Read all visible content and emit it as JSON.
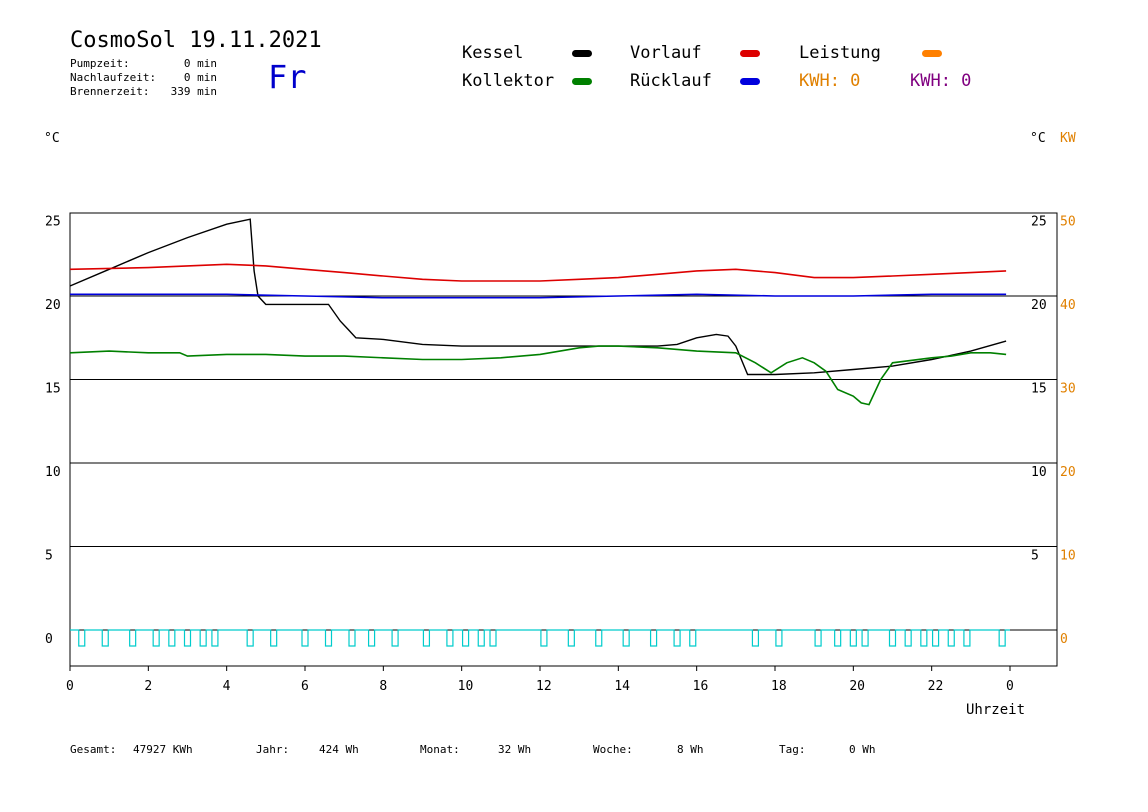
{
  "header": {
    "title": "CosmoSol 19.11.2021",
    "weekday": "Fr",
    "stats": [
      {
        "label": "Pumpzeit:",
        "value": "0 min"
      },
      {
        "label": "Nachlaufzeit:",
        "value": "0 min"
      },
      {
        "label": "Brennerzeit:",
        "value": "339 min"
      }
    ]
  },
  "legend": {
    "items": [
      {
        "label": "Kessel",
        "color": "#000000"
      },
      {
        "label": "Vorlauf",
        "color": "#dd0000"
      },
      {
        "label": "Leistung",
        "color": "#ff8000"
      },
      {
        "label": "Kollektor",
        "color": "#008000"
      },
      {
        "label": "Rücklauf",
        "color": "#0000dd"
      }
    ],
    "kwh_orange": "KWH: 0",
    "kwh_purple": "KWH: 0",
    "kwh_orange_color": "#e08000",
    "kwh_purple_color": "#800080"
  },
  "units": {
    "left": "°C",
    "right_c": "°C",
    "right_kw": "KW"
  },
  "footer": {
    "items": [
      {
        "label": "Gesamt:",
        "value": "47927 KWh"
      },
      {
        "label": "Jahr:",
        "value": "424 Wh"
      },
      {
        "label": "Monat:",
        "value": "32 Wh"
      },
      {
        "label": "Woche:",
        "value": "8 Wh"
      },
      {
        "label": "Tag:",
        "value": "0 Wh"
      }
    ]
  },
  "chart_data": {
    "type": "line",
    "xlabel": "Uhrzeit",
    "xlim": [
      0,
      24
    ],
    "ylim": [
      -2,
      26
    ],
    "x_ticks": [
      "0",
      "2",
      "4",
      "6",
      "8",
      "10",
      "12",
      "14",
      "16",
      "18",
      "20",
      "22",
      "0"
    ],
    "y_ticks_left": [
      25,
      20,
      15,
      10,
      5,
      0
    ],
    "y_ticks_right_c": [
      25,
      20,
      15,
      10,
      5
    ],
    "y_ticks_right_kw": [
      50,
      40,
      30,
      20,
      10,
      0
    ],
    "gridlines_y": [
      20,
      15,
      10,
      5,
      0
    ],
    "series": [
      {
        "name": "Kessel",
        "color": "#000000",
        "points": [
          [
            0,
            20.6
          ],
          [
            1,
            21.6
          ],
          [
            2,
            22.6
          ],
          [
            3,
            23.5
          ],
          [
            4,
            24.3
          ],
          [
            4.6,
            24.6
          ],
          [
            4.7,
            21.5
          ],
          [
            4.8,
            20.0
          ],
          [
            5,
            19.5
          ],
          [
            6,
            19.5
          ],
          [
            6.6,
            19.5
          ],
          [
            6.9,
            18.5
          ],
          [
            7.1,
            18.0
          ],
          [
            7.3,
            17.5
          ],
          [
            8,
            17.4
          ],
          [
            9,
            17.1
          ],
          [
            10,
            17.0
          ],
          [
            12,
            17.0
          ],
          [
            13,
            17.0
          ],
          [
            14,
            17.0
          ],
          [
            15,
            17.0
          ],
          [
            15.5,
            17.1
          ],
          [
            16,
            17.5
          ],
          [
            16.5,
            17.7
          ],
          [
            16.8,
            17.6
          ],
          [
            17,
            17.0
          ],
          [
            17.3,
            15.3
          ],
          [
            18,
            15.3
          ],
          [
            19,
            15.4
          ],
          [
            20,
            15.6
          ],
          [
            21,
            15.8
          ],
          [
            22,
            16.2
          ],
          [
            23,
            16.7
          ],
          [
            23.9,
            17.3
          ]
        ]
      },
      {
        "name": "Vorlauf",
        "color": "#dd0000",
        "points": [
          [
            0,
            21.6
          ],
          [
            2,
            21.7
          ],
          [
            4,
            21.9
          ],
          [
            5,
            21.8
          ],
          [
            6,
            21.6
          ],
          [
            7,
            21.4
          ],
          [
            8,
            21.2
          ],
          [
            9,
            21.0
          ],
          [
            10,
            20.9
          ],
          [
            12,
            20.9
          ],
          [
            13,
            21.0
          ],
          [
            14,
            21.1
          ],
          [
            15,
            21.3
          ],
          [
            16,
            21.5
          ],
          [
            17,
            21.6
          ],
          [
            18,
            21.4
          ],
          [
            19,
            21.1
          ],
          [
            20,
            21.1
          ],
          [
            21,
            21.2
          ],
          [
            22,
            21.3
          ],
          [
            23,
            21.4
          ],
          [
            23.9,
            21.5
          ]
        ]
      },
      {
        "name": "Rücklauf",
        "color": "#0000dd",
        "points": [
          [
            0,
            20.1
          ],
          [
            2,
            20.1
          ],
          [
            4,
            20.1
          ],
          [
            6,
            20.0
          ],
          [
            8,
            19.9
          ],
          [
            10,
            19.9
          ],
          [
            12,
            19.9
          ],
          [
            14,
            20.0
          ],
          [
            16,
            20.1
          ],
          [
            18,
            20.0
          ],
          [
            20,
            20.0
          ],
          [
            22,
            20.1
          ],
          [
            23.9,
            20.1
          ]
        ]
      },
      {
        "name": "Kollektor",
        "color": "#008000",
        "points": [
          [
            0,
            16.6
          ],
          [
            1,
            16.7
          ],
          [
            2,
            16.6
          ],
          [
            2.8,
            16.6
          ],
          [
            3,
            16.4
          ],
          [
            4,
            16.5
          ],
          [
            5,
            16.5
          ],
          [
            6,
            16.4
          ],
          [
            7,
            16.4
          ],
          [
            8,
            16.3
          ],
          [
            9,
            16.2
          ],
          [
            10,
            16.2
          ],
          [
            11,
            16.3
          ],
          [
            12,
            16.5
          ],
          [
            13,
            16.9
          ],
          [
            13.5,
            17.0
          ],
          [
            14,
            17.0
          ],
          [
            15,
            16.9
          ],
          [
            16,
            16.7
          ],
          [
            17,
            16.6
          ],
          [
            17.5,
            16.0
          ],
          [
            17.9,
            15.4
          ],
          [
            18.3,
            16.0
          ],
          [
            18.7,
            16.3
          ],
          [
            19,
            16.0
          ],
          [
            19.3,
            15.5
          ],
          [
            19.6,
            14.4
          ],
          [
            20,
            14.0
          ],
          [
            20.2,
            13.6
          ],
          [
            20.4,
            13.5
          ],
          [
            20.7,
            15.0
          ],
          [
            21,
            16.0
          ],
          [
            22,
            16.3
          ],
          [
            22.5,
            16.4
          ],
          [
            23,
            16.6
          ],
          [
            23.5,
            16.6
          ],
          [
            23.9,
            16.5
          ]
        ]
      }
    ],
    "pump_pulses_hours": [
      0.3,
      0.9,
      1.6,
      2.2,
      2.6,
      3.0,
      3.4,
      3.7,
      4.6,
      5.2,
      6.0,
      6.6,
      7.2,
      7.7,
      8.3,
      9.1,
      9.7,
      10.1,
      10.5,
      10.8,
      12.1,
      12.8,
      13.5,
      14.2,
      14.9,
      15.5,
      15.9,
      17.5,
      18.1,
      19.1,
      19.6,
      20.0,
      20.3,
      21.0,
      21.4,
      21.8,
      22.1,
      22.5,
      22.9,
      23.8
    ],
    "pump_color": "#00cccc"
  }
}
